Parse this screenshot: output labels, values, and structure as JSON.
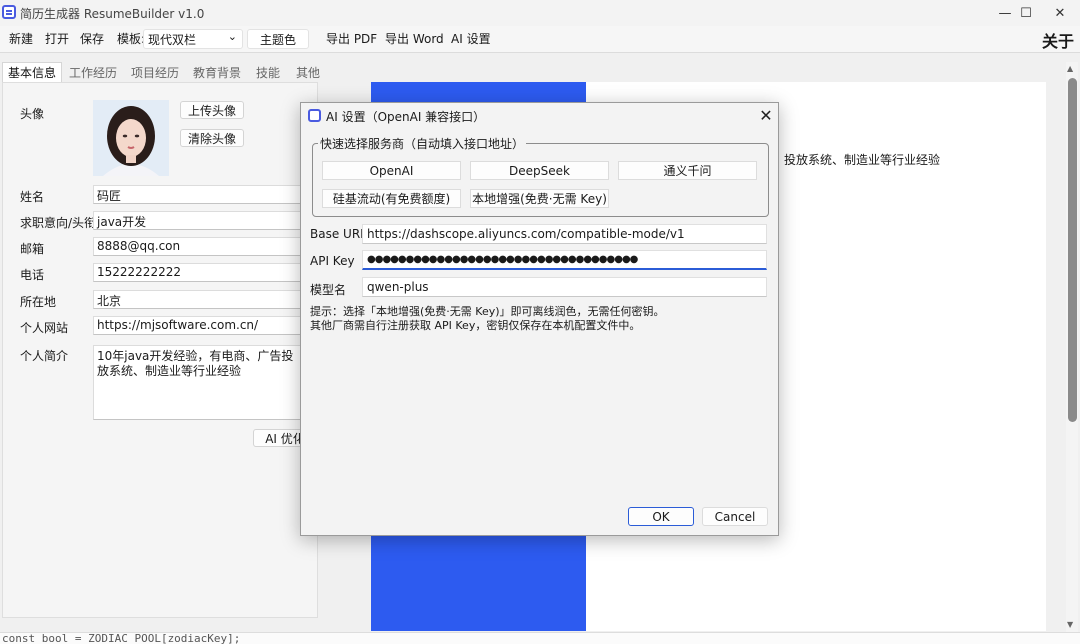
{
  "window": {
    "title": "简历生成器 ResumeBuilder  v1.0",
    "controls": {
      "minimize": "—",
      "maximize": "☐",
      "close": "✕"
    }
  },
  "toolbar": {
    "new": "新建",
    "open": "打开",
    "save": "保存",
    "template_label": "模板:",
    "template_value": "现代双栏",
    "theme_color": "主题色",
    "export_pdf": "导出 PDF",
    "export_word": "导出 Word",
    "ai_settings": "AI 设置",
    "about": "关于"
  },
  "tabs": [
    "基本信息",
    "工作经历",
    "项目经历",
    "教育背景",
    "技能",
    "其他"
  ],
  "form": {
    "avatar_label": "头像",
    "upload_avatar": "上传头像",
    "clear_avatar": "清除头像",
    "name_label": "姓名",
    "name_value": "码匠",
    "job_label": "求职意向/头衔",
    "job_value": "java开发",
    "email_label": "邮箱",
    "email_value": "8888@qq.con",
    "phone_label": "电话",
    "phone_value": "15222222222",
    "location_label": "所在地",
    "location_value": "北京",
    "website_label": "个人网站",
    "website_value": "https://mjsoftware.com.cn/",
    "bio_label": "个人简介",
    "bio_value": "10年java开发经验，有电商、广告投放系统、制造业等行业经验",
    "ai_optimize": "AI 优化"
  },
  "preview": {
    "visible_text": "投放系统、制造业等行业经验",
    "accent_color": "#2d5bf0"
  },
  "bottom_strip": "const bool = ZODIAC_POOL[zodiacKey];",
  "dialog": {
    "title": "AI 设置（OpenAI 兼容接口）",
    "close": "✕",
    "group_title": "快速选择服务商（自动填入接口地址）",
    "providers": [
      "OpenAI",
      "DeepSeek",
      "通义千问",
      "硅基流动(有免费额度)",
      "本地增强(免费·无需 Key)"
    ],
    "base_url_label": "Base URL",
    "base_url_value": "https://dashscope.aliyuncs.com/compatible-mode/v1",
    "api_key_label": "API Key",
    "api_key_value": "●●●●●●●●●●●●●●●●●●●●●●●●●●●●●●●●●●●",
    "model_label": "模型名",
    "model_value": "qwen-plus",
    "hint_line1": "提示：选择「本地增强(免费·无需 Key)」即可离线润色，无需任何密钥。",
    "hint_line2": "其他厂商需自行注册获取 API Key，密钥仅保存在本机配置文件中。",
    "ok": "OK",
    "cancel": "Cancel"
  }
}
